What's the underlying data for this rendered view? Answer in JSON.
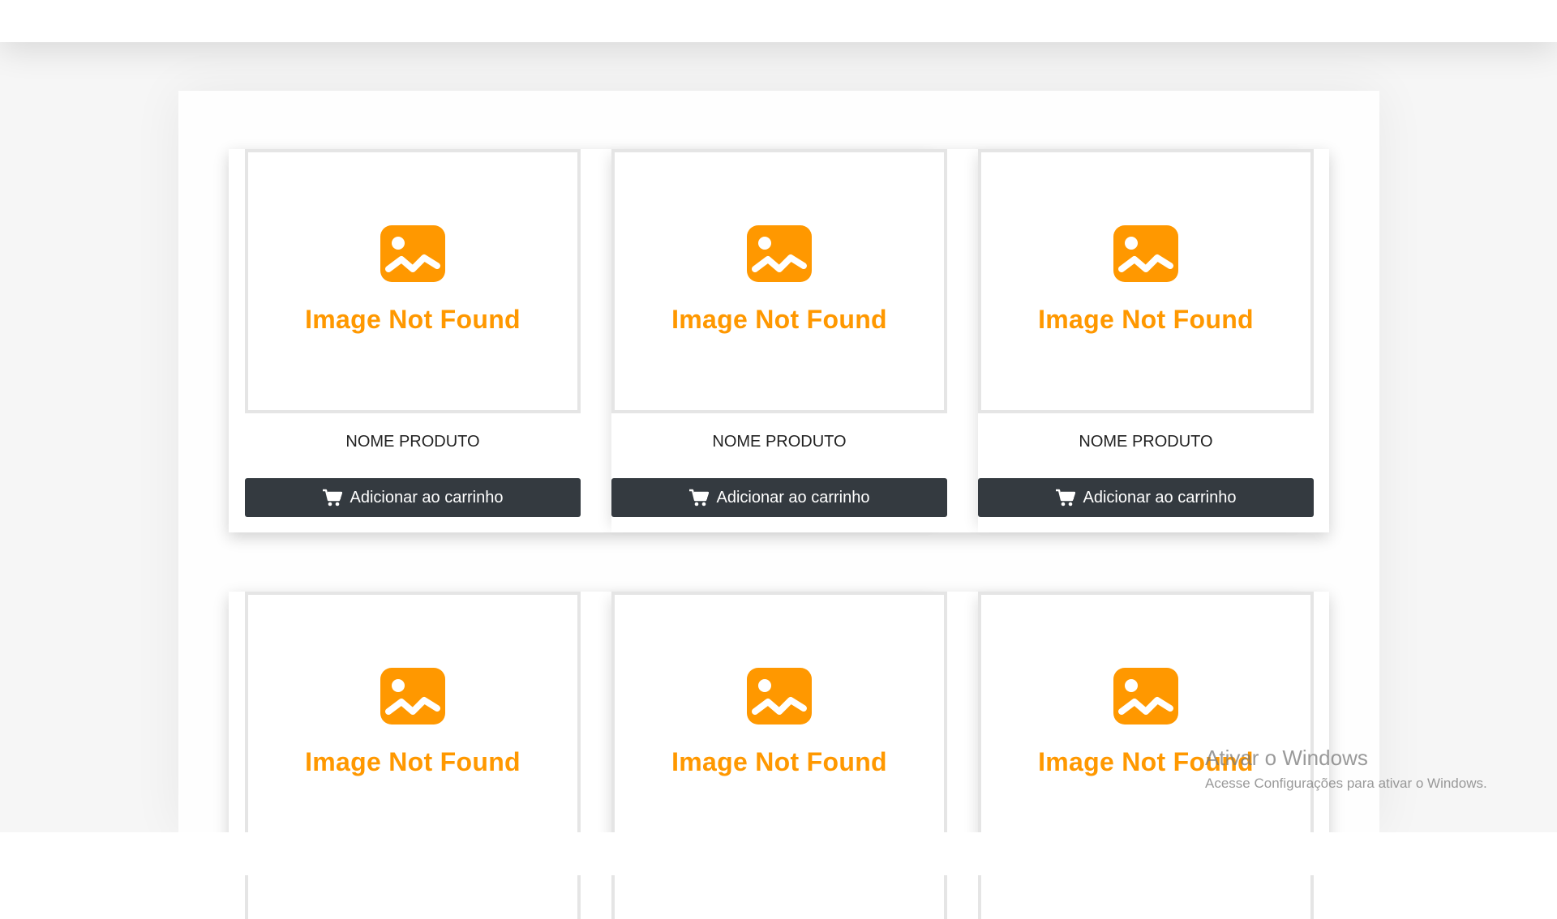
{
  "products": [
    {
      "image_text": "Image Not Found",
      "name": "NOME PRODUTO",
      "button_label": "Adicionar ao carrinho"
    },
    {
      "image_text": "Image Not Found",
      "name": "NOME PRODUTO",
      "button_label": "Adicionar ao carrinho"
    },
    {
      "image_text": "Image Not Found",
      "name": "NOME PRODUTO",
      "button_label": "Adicionar ao carrinho"
    },
    {
      "image_text": "Image Not Found"
    },
    {
      "image_text": "Image Not Found"
    },
    {
      "image_text": "Image Not Found"
    }
  ],
  "watermark": {
    "title": "Ativar o Windows",
    "subtitle": "Acesse Configurações para ativar o Windows."
  },
  "colors": {
    "placeholder_accent": "#ff9800",
    "button_bg": "#343a40",
    "button_text": "#ffffff"
  },
  "icons": {
    "placeholder": "image-placeholder-icon",
    "cart": "cart-icon"
  }
}
